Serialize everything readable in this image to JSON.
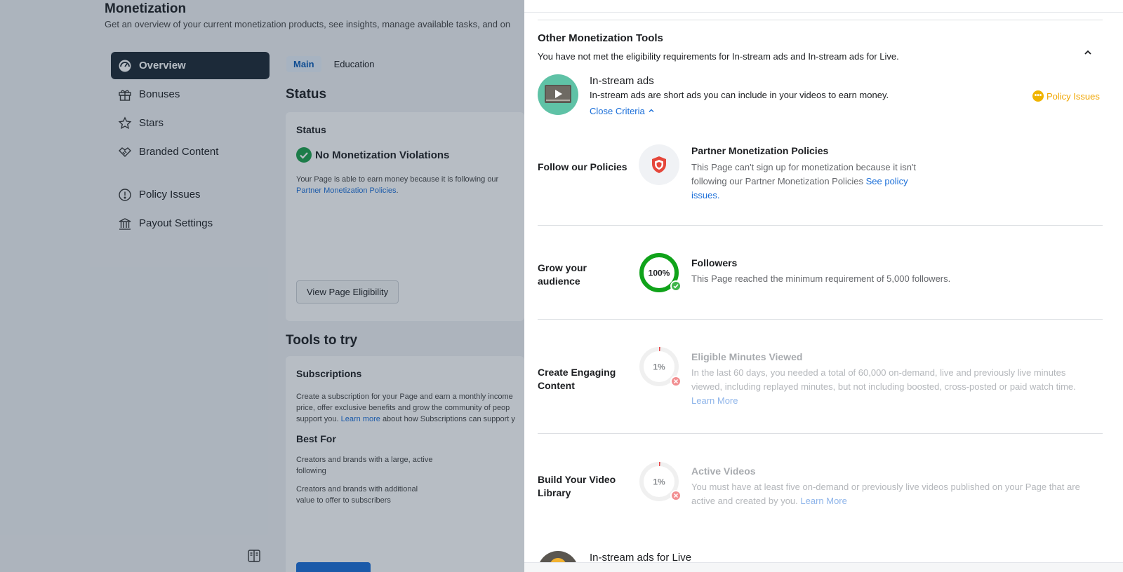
{
  "background": {
    "title": "Monetization",
    "subtitle": "Get an overview of your current monetization products, see insights, manage available tasks, and on",
    "nav": [
      {
        "label": "Overview",
        "icon": "dashboard-icon",
        "active": true
      },
      {
        "label": "Bonuses",
        "icon": "gift-icon"
      },
      {
        "label": "Stars",
        "icon": "star-icon"
      },
      {
        "label": "Branded Content",
        "icon": "handshake-icon"
      },
      {
        "label": "Policy Issues",
        "icon": "alert-circle-icon"
      },
      {
        "label": "Payout Settings",
        "icon": "bank-icon"
      }
    ],
    "tabs": [
      "Main",
      "Education"
    ],
    "status_section_title": "Status",
    "status_card": {
      "heading": "Status",
      "status": "No Monetization Violations",
      "text": "Your Page is able to earn money because it is following our",
      "link": "Partner Monetization Policies",
      "link_suffix": ".",
      "button": "View Page Eligibility"
    },
    "tools_section_title": "Tools to try",
    "subscriptions_card": {
      "heading": "Subscriptions",
      "text_lines": [
        "Create a subscription for your Page and earn a monthly income",
        "price, offer exclusive benefits and grow the community of peop",
        "support you."
      ],
      "learn_more": "Learn more",
      "text_suffix": "about how Subscriptions can support y",
      "best_for_title": "Best For",
      "best_for_1": "Creators and brands with a large, active following",
      "best_for_2": "Creators and brands with additional value to offer to subscribers"
    }
  },
  "panel": {
    "section_title": "Other Monetization Tools",
    "section_subtitle": "You have not met the eligibility requirements for In-stream ads and In-stream ads for Live.",
    "product": {
      "name": "In-stream ads",
      "description": "In-stream ads are short ads you can include in your videos to earn money.",
      "close_criteria": "Close Criteria",
      "badge": "Policy Issues",
      "badge_color": "#F0A500"
    },
    "criteria": [
      {
        "label": "Follow our Policies",
        "title": "Partner Monetization Policies",
        "description": "This Page can't sign up for monetization because it isn't following our Partner Monetization Policies",
        "link": "See policy issues.",
        "icon": "shield-icon"
      },
      {
        "label": "Grow your audience",
        "title": "Followers",
        "progress_text": "100%",
        "progress": 1.0,
        "description": "This Page reached the minimum requirement of 5,000 followers.",
        "status": "met"
      },
      {
        "label": "Create Engaging Content",
        "title": "Eligible Minutes Viewed",
        "progress_text": "1%",
        "progress": 0.01,
        "description": "In the last 60 days, you needed a total of 60,000 on-demand, live and previously live minutes viewed, including replayed minutes, but not including boosted, cross-posted or paid watch time.",
        "link": "Learn More",
        "status": "not-met"
      },
      {
        "label": "Build Your Video Library",
        "title": "Active Videos",
        "progress_text": "1%",
        "progress": 0.01,
        "description": "You must have at least five on-demand or previously live videos published on your Page that are active and created by you.",
        "link": "Learn More",
        "status": "not-met"
      }
    ],
    "next_product": "In-stream ads for Live"
  },
  "colors": {
    "accent": "#1A6ED8",
    "success": "#1BA04B",
    "ring_full": "#10A31A",
    "error_x": "#F28F91",
    "warning": "#F0A500"
  }
}
